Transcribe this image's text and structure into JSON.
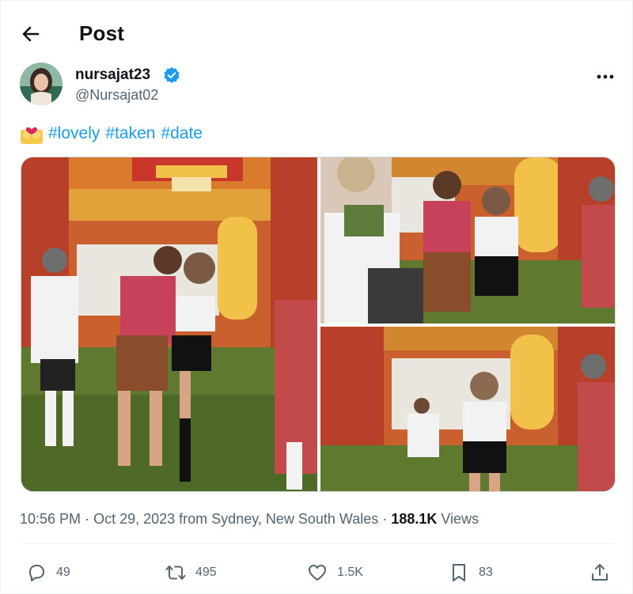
{
  "header": {
    "title": "Post"
  },
  "author": {
    "display_name": "nursajat23",
    "handle": "@Nursajat02",
    "verified": true
  },
  "tweet": {
    "emoji": "couple-with-heart-emoji",
    "hashtags": [
      "#lovely",
      "#taken",
      "#date"
    ]
  },
  "media": {
    "photos": [
      {
        "name": "photo-1",
        "description_icon": "image-icon"
      },
      {
        "name": "photo-2",
        "description_icon": "image-icon"
      },
      {
        "name": "photo-3",
        "description_icon": "image-icon"
      }
    ]
  },
  "meta": {
    "time": "10:56 PM",
    "date": "Oct 29, 2023",
    "location": "from Sydney, New South Wales",
    "views_count": "188.1K",
    "views_label": "Views",
    "separator": "·"
  },
  "actions": {
    "reply_count": "49",
    "repost_count": "495",
    "like_count": "1.5K",
    "bookmark_count": "83"
  },
  "colors": {
    "accent": "#1d9bf0",
    "muted": "#536471",
    "text": "#0f1419",
    "divider": "#eff3f4"
  }
}
